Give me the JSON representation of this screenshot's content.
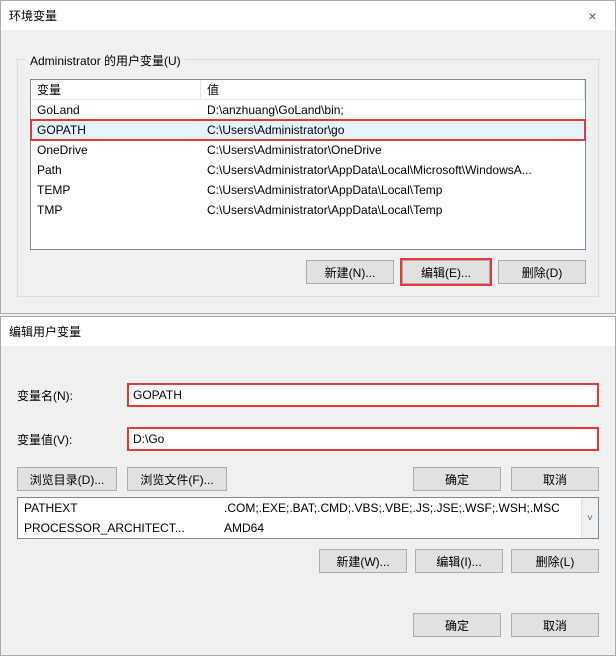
{
  "dialog1": {
    "title": "环境变量",
    "close": "×",
    "group_title": "Administrator 的用户变量(U)",
    "headers": {
      "var": "变量",
      "val": "值"
    },
    "rows": [
      {
        "var": "GoLand",
        "val": "D:\\anzhuang\\GoLand\\bin;"
      },
      {
        "var": "GOPATH",
        "val": "C:\\Users\\Administrator\\go"
      },
      {
        "var": "OneDrive",
        "val": "C:\\Users\\Administrator\\OneDrive"
      },
      {
        "var": "Path",
        "val": "C:\\Users\\Administrator\\AppData\\Local\\Microsoft\\WindowsA..."
      },
      {
        "var": "TEMP",
        "val": "C:\\Users\\Administrator\\AppData\\Local\\Temp"
      },
      {
        "var": "TMP",
        "val": "C:\\Users\\Administrator\\AppData\\Local\\Temp"
      }
    ],
    "buttons": {
      "new": "新建(N)...",
      "edit": "编辑(E)...",
      "del": "删除(D)"
    }
  },
  "dialog2": {
    "title": "编辑用户变量",
    "name_label": "变量名(N):",
    "name_value": "GOPATH",
    "value_label": "变量值(V):",
    "value_value": "D:\\Go",
    "browse_dir": "浏览目录(D)...",
    "browse_file": "浏览文件(F)...",
    "ok": "确定",
    "cancel": "取消",
    "sysrows": [
      {
        "var": "PATHEXT",
        "val": ".COM;.EXE;.BAT;.CMD;.VBS;.VBE;.JS;.JSE;.WSF;.WSH;.MSC"
      },
      {
        "var": "PROCESSOR_ARCHITECT...",
        "val": "AMD64"
      }
    ],
    "scroll_glyph": "˅",
    "buttons2": {
      "new": "新建(W)...",
      "edit": "编辑(I)...",
      "del": "删除(L)"
    },
    "bottom": {
      "ok": "确定",
      "cancel": "取消"
    }
  }
}
